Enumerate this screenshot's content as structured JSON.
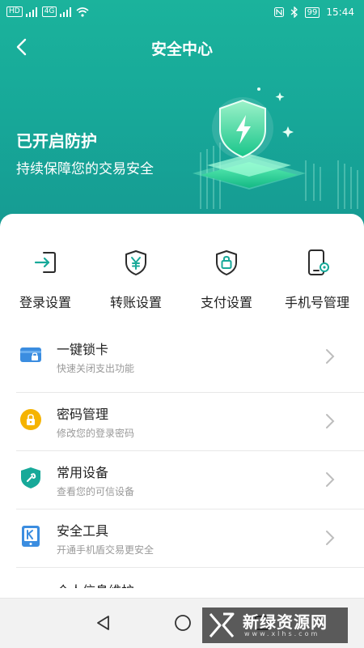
{
  "status_bar": {
    "left_chips": [
      "HD",
      "4G"
    ],
    "battery": "99",
    "time": "15:44"
  },
  "nav": {
    "title": "安全中心"
  },
  "hero": {
    "title": "已开启防护",
    "subtitle": "持续保障您的交易安全"
  },
  "quick_actions": [
    {
      "label": "登录设置",
      "icon": "login-icon"
    },
    {
      "label": "转账设置",
      "icon": "transfer-shield-icon"
    },
    {
      "label": "支付设置",
      "icon": "payment-shield-icon"
    },
    {
      "label": "手机号管理",
      "icon": "phone-settings-icon"
    }
  ],
  "list": [
    {
      "title": "一键锁卡",
      "subtitle": "快速关闭支出功能",
      "icon": "card-lock-icon",
      "color": "#3b8de0"
    },
    {
      "title": "密码管理",
      "subtitle": "修改您的登录密码",
      "icon": "password-lock-icon",
      "color": "#f5b300"
    },
    {
      "title": "常用设备",
      "subtitle": "查看您的可信设备",
      "icon": "device-shield-icon",
      "color": "#17a999"
    },
    {
      "title": "安全工具",
      "subtitle": "开通手机盾交易更安全",
      "icon": "security-tool-icon",
      "color": "#3b8de0"
    }
  ],
  "partial_row": {
    "title": "个人信息维护"
  },
  "watermark": {
    "text": "新绿资源网",
    "url": "www.xlhs.com"
  },
  "colors": {
    "accent": "#17a999",
    "header_start": "#1bb39c",
    "header_end": "#169a92"
  }
}
